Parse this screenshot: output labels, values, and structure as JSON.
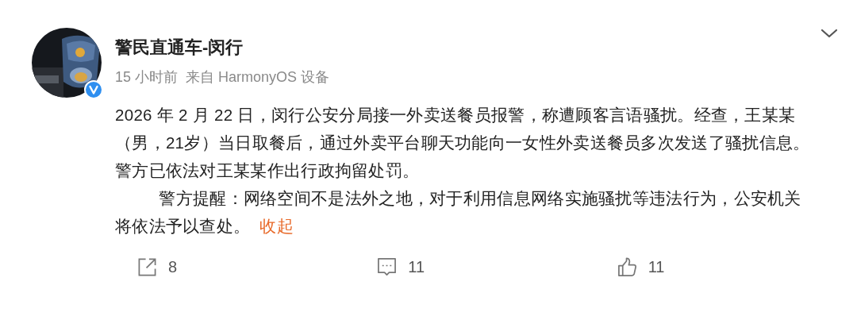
{
  "post": {
    "author": "警民直通车-闵行",
    "verified": true,
    "time": "15 小时前",
    "source": "来自 HarmonyOS 设备",
    "paragraphs": [
      "2026 年 2 月 22 日，闵行公安分局接一外卖送餐员报警，称遭顾客言语骚扰。经查，王某某（男，21岁）当日取餐后，通过外卖平台聊天功能向一女性外卖送餐员多次发送了骚扰信息。警方已依法对王某某作出行政拘留处罚。",
      "警方提醒：网络空间不是法外之地，对于利用信息网络实施骚扰等违法行为，公安机关将依法予以查处。"
    ],
    "collapse_link": "收起",
    "actions": [
      {
        "kind": "share",
        "count": "8"
      },
      {
        "kind": "comment",
        "count": "11"
      },
      {
        "kind": "like",
        "count": "11"
      }
    ]
  }
}
